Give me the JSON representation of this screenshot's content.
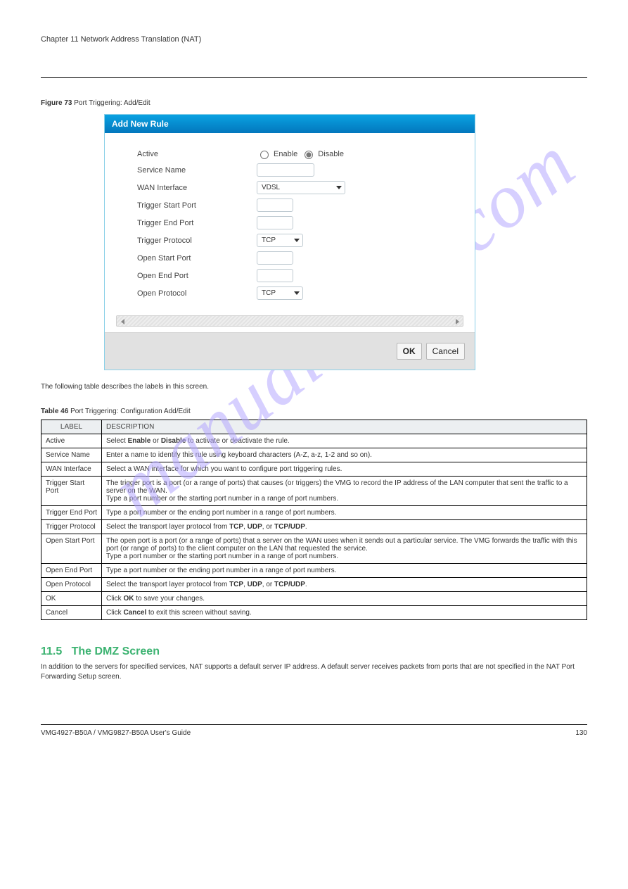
{
  "chapter": "Chapter 11 Network Address Translation (NAT)",
  "figure_caption_prefix": "Figure 73  ",
  "figure_caption": "Port Triggering: Add/Edit",
  "dialog": {
    "title": "Add New Rule",
    "rows": {
      "active": "Active",
      "enable": "Enable",
      "disable": "Disable",
      "service_name": "Service Name",
      "wan_interface": "WAN Interface",
      "wan_value": "VDSL",
      "trig_start": "Trigger Start Port",
      "trig_end": "Trigger End Port",
      "trig_proto": "Trigger Protocol",
      "trig_proto_value": "TCP",
      "open_start": "Open Start Port",
      "open_end": "Open End Port",
      "open_proto": "Open Protocol",
      "open_proto_value": "TCP"
    },
    "ok": "OK",
    "cancel": "Cancel"
  },
  "table_caption_prefix": "Table 46  ",
  "table_caption": "Port Triggering: Configuration Add/Edit",
  "table": {
    "head_label": "LABEL",
    "head_desc": "DESCRIPTION",
    "rows": [
      {
        "l": "Active",
        "d_pre": "Select ",
        "b1": "Enable",
        "d_mid": " or ",
        "b2": "Disable",
        "d_post": " to activate or deactivate the rule."
      },
      {
        "l": "Service Name",
        "d": "Enter a name to identify this rule using keyboard characters (A-Z, a-z, 1-2 and so on)."
      },
      {
        "l": "WAN Interface",
        "d": "Select a WAN interface for which you want to configure port triggering rules."
      },
      {
        "l": "Trigger Start Port",
        "d": "The trigger port is a port (or a range of ports) that causes (or triggers) the VMG to record the IP address of the LAN computer that sent the traffic to a server on the WAN.\nType a port number or the starting port number in a range of port numbers."
      },
      {
        "l": "Trigger End Port",
        "d": "Type a port number or the ending port number in a range of port numbers."
      },
      {
        "l": "Trigger Protocol",
        "d_pre": "Select the transport layer protocol from ",
        "b1": "TCP",
        "d_mid1": ", ",
        "b2": "UDP",
        "d_mid2": ", or ",
        "b3": "TCP/UDP",
        "d_post": "."
      },
      {
        "l": "Open Start Port",
        "d": "The open port is a port (or a range of ports) that a server on the WAN uses when it sends out a particular service. The VMG forwards the traffic with this port (or range of ports) to the client computer on the LAN that requested the service.\nType a port number or the starting port number in a range of port numbers."
      },
      {
        "l": "Open End Port",
        "d": "Type a port number or the ending port number in a range of port numbers."
      },
      {
        "l": "Open Protocol",
        "d_pre": "Select the transport layer protocol from ",
        "b1": "TCP",
        "d_mid1": ", ",
        "b2": "UDP",
        "d_mid2": ", or ",
        "b3": "TCP/UDP",
        "d_post": "."
      },
      {
        "l": "OK",
        "d_pre": "Click ",
        "b1": "OK",
        "d_post": " to save your changes."
      },
      {
        "l": "Cancel",
        "d_pre": "Click ",
        "b1": "Cancel",
        "d_post": " to exit this screen without saving."
      }
    ]
  },
  "section": {
    "number": "11.5",
    "title": "The DMZ Screen",
    "body": "In addition to the servers for specified services, NAT supports a default server IP address. A default server receives packets from ports that are not specified in the NAT Port Forwarding Setup screen."
  },
  "footer": {
    "left": "VMG4927-B50A / VMG9827-B50A User's Guide",
    "right": "130"
  },
  "watermark": "manualshive.com"
}
